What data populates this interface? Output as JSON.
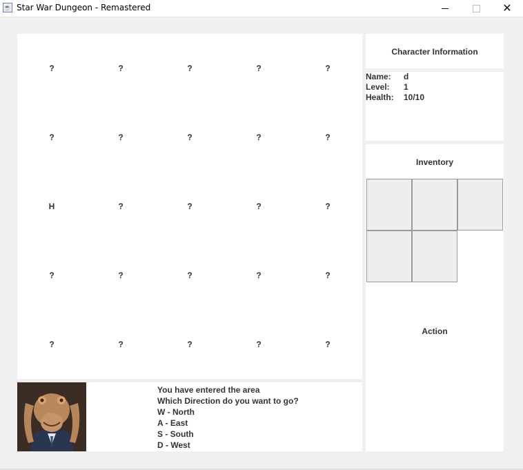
{
  "window": {
    "title": "Star War Dungeon - Remastered",
    "icon": "java-cup-icon"
  },
  "map": {
    "cells": [
      [
        "?",
        "?",
        "?",
        "?",
        "?"
      ],
      [
        "?",
        "?",
        "?",
        "?",
        "?"
      ],
      [
        "H",
        "?",
        "?",
        "?",
        "?"
      ],
      [
        "?",
        "?",
        "?",
        "?",
        "?"
      ],
      [
        "?",
        "?",
        "?",
        "?",
        "?"
      ]
    ]
  },
  "messages": {
    "lines": [
      "You have entered the area",
      "Which Direction do you want to go?",
      "W - North",
      "A - East",
      "S - South",
      "D - West"
    ]
  },
  "character": {
    "header": "Character Information",
    "name_label": "Name:",
    "name_value": "d",
    "level_label": "Level:",
    "level_value": "1",
    "health_label": "Health:",
    "health_value": "10/10"
  },
  "inventory": {
    "title": "Inventory",
    "slot_count": 5
  },
  "action": {
    "title": "Action"
  }
}
